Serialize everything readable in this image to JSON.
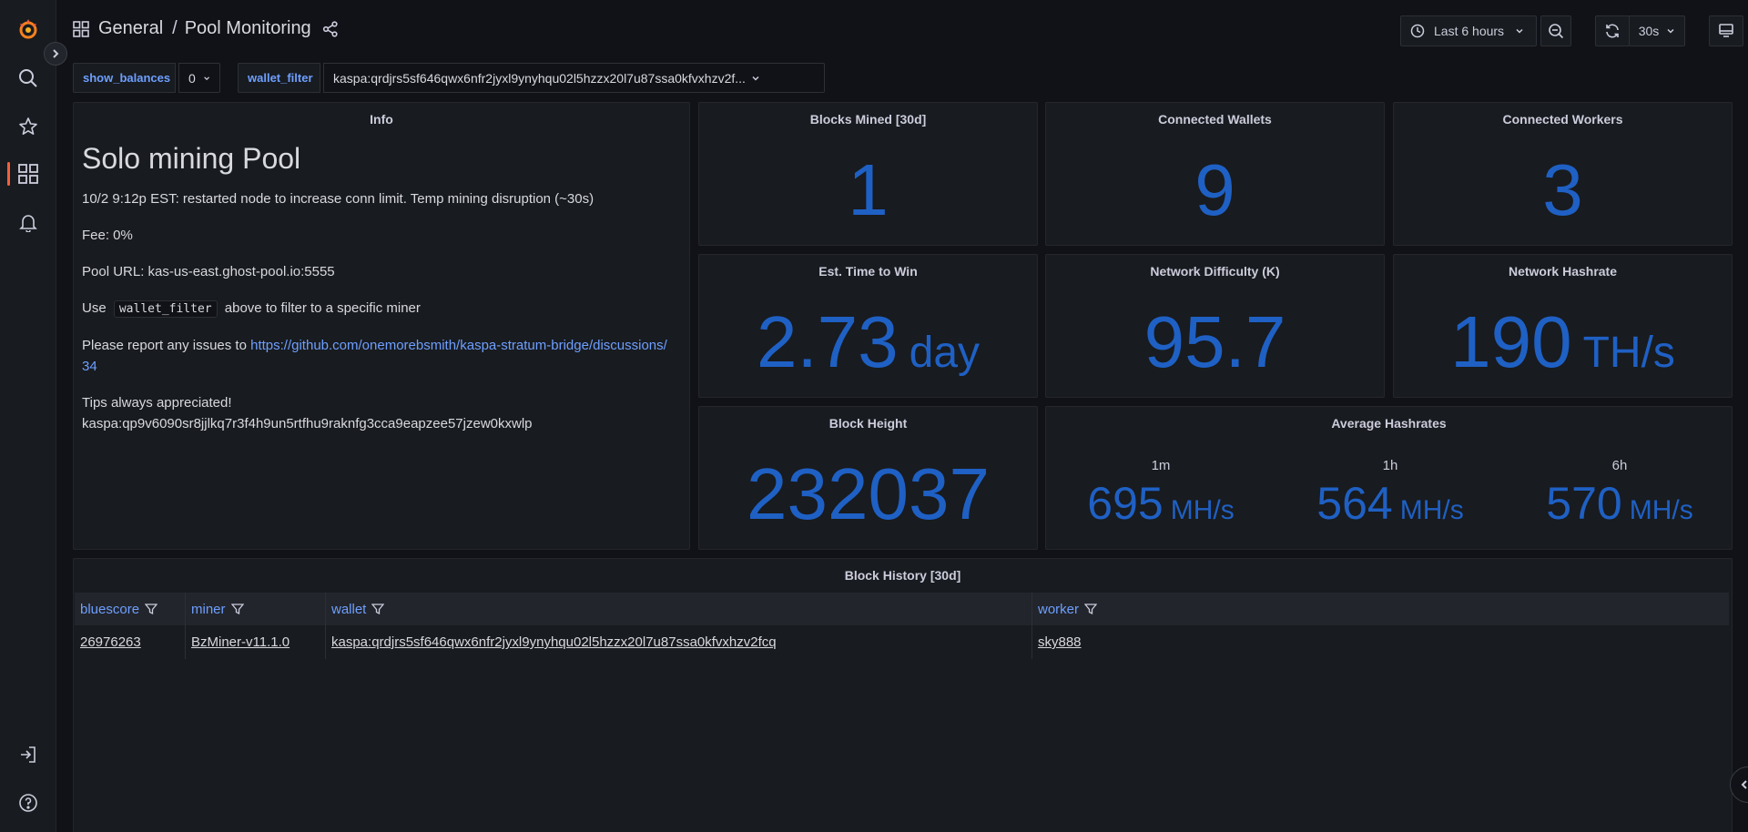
{
  "breadcrumb": {
    "folder": "General",
    "separator": "/",
    "dashboard": "Pool Monitoring"
  },
  "toolbar": {
    "time_range": "Last 6 hours",
    "refresh_interval": "30s"
  },
  "variables": [
    {
      "label": "show_balances",
      "value": "0"
    },
    {
      "label": "wallet_filter",
      "value": "kaspa:qrdjrs5sf646qwx6nfr2jyxl9ynyhqu02l5hzzx20l7u87ssa0kfvxhzv2f..."
    }
  ],
  "info": {
    "title": "Info",
    "heading": "Solo mining Pool",
    "line1": "10/2 9:12p EST: restarted node to increase conn limit. Temp mining disruption (~30s)",
    "fee": "Fee: 0%",
    "pool_url": "Pool URL: kas-us-east.ghost-pool.io:5555",
    "use_prefix": "Use",
    "use_code": "wallet_filter",
    "use_suffix": "above to filter to a specific miner",
    "report_prefix": "Please report any issues to",
    "report_link": "https://github.com/onemorebsmith/kaspa-stratum-bridge/discussions/34",
    "tips_line1": "Tips always appreciated!",
    "tips_line2": "kaspa:qp9v6090sr8jjlkq7r3f4h9un5rtfhu9raknfg3cca9eapzee57jzew0kxwlp"
  },
  "stats": {
    "blocks_mined": {
      "title": "Blocks Mined [30d]",
      "value": "1"
    },
    "connected_wallets": {
      "title": "Connected Wallets",
      "value": "9"
    },
    "connected_workers": {
      "title": "Connected Workers",
      "value": "3"
    },
    "est_time": {
      "title": "Est. Time to Win",
      "value": "2.73",
      "unit": "day"
    },
    "network_difficulty": {
      "title": "Network Difficulty (K)",
      "value": "95.7"
    },
    "network_hashrate": {
      "title": "Network Hashrate",
      "value": "190",
      "unit": "TH/s"
    },
    "block_height": {
      "title": "Block Height",
      "value": "232037"
    }
  },
  "avg_hashrates": {
    "title": "Average Hashrates",
    "items": [
      {
        "label": "1m",
        "value": "695",
        "unit": "MH/s"
      },
      {
        "label": "1h",
        "value": "564",
        "unit": "MH/s"
      },
      {
        "label": "6h",
        "value": "570",
        "unit": "MH/s"
      }
    ]
  },
  "block_history": {
    "title": "Block History [30d]",
    "columns": [
      "bluescore",
      "miner",
      "wallet",
      "worker"
    ],
    "rows": [
      {
        "bluescore": "26976263",
        "miner": "BzMiner-v11.1.0",
        "wallet": "kaspa:qrdjrs5sf646qwx6nfr2jyxl9ynyhqu02l5hzzx20l7u87ssa0kfvxhzv2fcq",
        "worker": "sky888"
      }
    ]
  },
  "colors": {
    "stat_blue": "#1f60c4",
    "link_blue": "#6e9fff",
    "brand_orange": "#f55f3e"
  }
}
